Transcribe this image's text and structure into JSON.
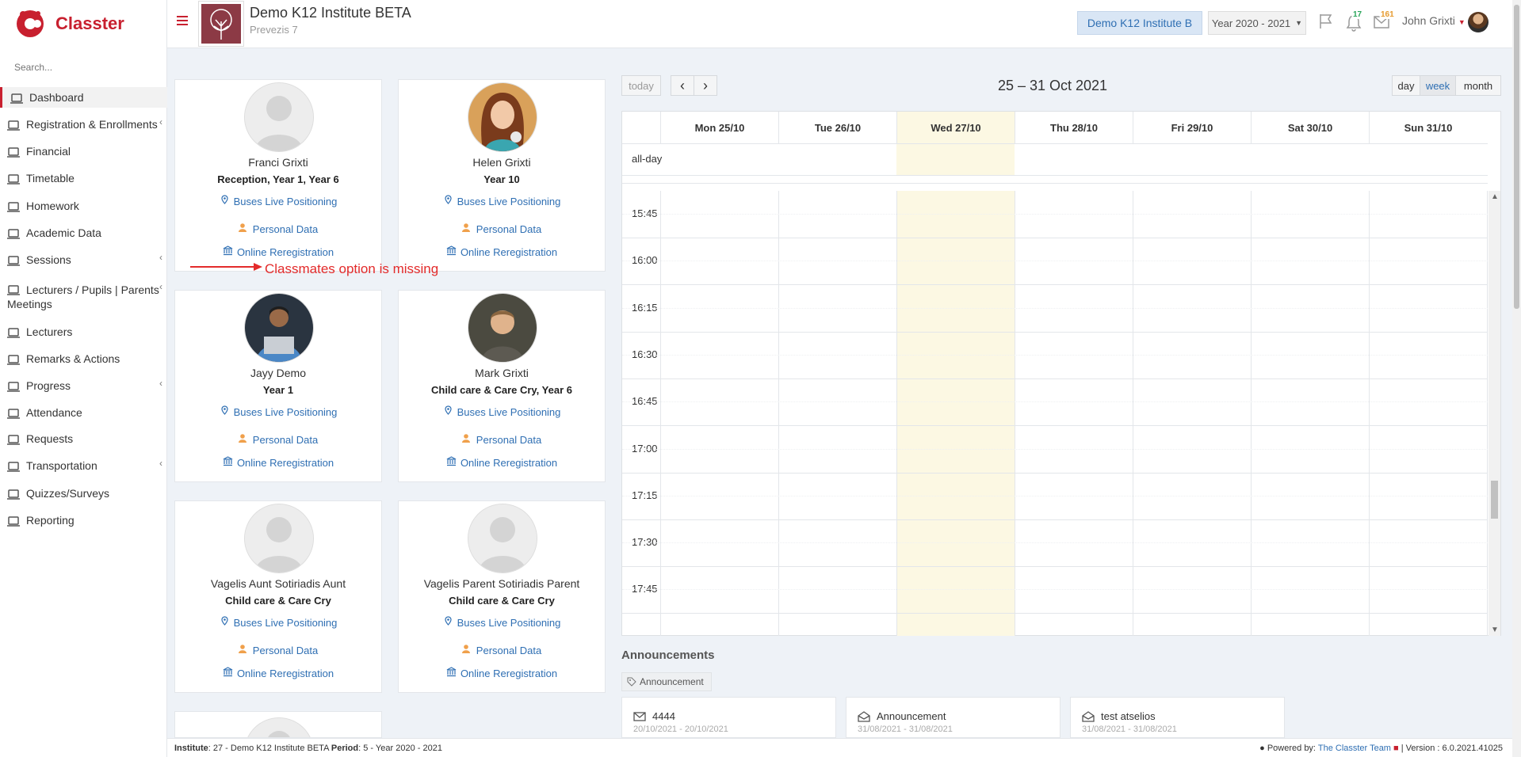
{
  "app": {
    "brand": "Classter"
  },
  "sidebar": {
    "search_placeholder": "Search...",
    "items": [
      {
        "label": "Dashboard",
        "icon": "laptop-icon"
      },
      {
        "label": "Registration & Enrollments",
        "icon": "bank-icon"
      },
      {
        "label": "Financial",
        "icon": "coins-icon"
      },
      {
        "label": "Timetable",
        "icon": "calendar-icon"
      },
      {
        "label": "Homework",
        "icon": "list-icon"
      },
      {
        "label": "Academic Data",
        "icon": "chart-icon"
      },
      {
        "label": "Sessions",
        "icon": "coins-icon"
      },
      {
        "label": "Lecturers / Pupils | Parents",
        "label2": "Meetings",
        "icon": "users-icon"
      },
      {
        "label": "Lecturers",
        "icon": "user-icon"
      },
      {
        "label": "Remarks & Actions",
        "icon": "shuffle-icon"
      },
      {
        "label": "Progress",
        "icon": "graduation-cap-icon"
      },
      {
        "label": "Attendance",
        "icon": "user-check-icon"
      },
      {
        "label": "Requests",
        "icon": "document-icon"
      },
      {
        "label": "Transportation",
        "icon": "bus-icon"
      },
      {
        "label": "Quizzes/Surveys",
        "icon": "list-icon"
      },
      {
        "label": "Reporting",
        "icon": "printer-icon"
      }
    ]
  },
  "header": {
    "institute_title": "Demo K12 Institute BETA",
    "institute_subtitle": "Prevezis 7",
    "institute_button": "Demo K12 Institute B",
    "year_select": "Year 2020 - 2021",
    "notifications_count": "17",
    "messages_count": "161",
    "user_name": "John Grixti"
  },
  "cards": [
    {
      "name": "Franci Grixti",
      "year": "Reception, Year 1, Year 6",
      "photo": "placeholder"
    },
    {
      "name": "Helen Grixti",
      "year": "Year 10",
      "photo": "girl"
    },
    {
      "name": "Jayy Demo",
      "year": "Year 1",
      "photo": "man"
    },
    {
      "name": "Mark Grixti",
      "year": "Child care & Care Cry, Year 6",
      "photo": "boy"
    },
    {
      "name": "Vagelis Aunt Sotiriadis Aunt",
      "year": "Child care & Care Cry",
      "photo": "placeholder"
    },
    {
      "name": "Vagelis Parent Sotiriadis Parent",
      "year": "Child care & Care Cry",
      "photo": "placeholder"
    }
  ],
  "card_links": {
    "buses": "Buses Live Positioning",
    "personal": "Personal Data",
    "rereg": "Online Reregistration"
  },
  "annotation": "Classmates option is missing",
  "calendar": {
    "title": "25 – 31 Oct 2021",
    "today": "today",
    "prev": "‹",
    "next": "›",
    "view_day": "day",
    "view_week": "week",
    "view_month": "month",
    "allday": "all-day",
    "days": [
      "Mon 25/10",
      "Tue 26/10",
      "Wed 27/10",
      "Thu 28/10",
      "Fri 29/10",
      "Sat 30/10",
      "Sun 31/10"
    ],
    "today_index": 2,
    "times": [
      "15:45",
      "16:00",
      "16:15",
      "16:30",
      "16:45",
      "17:00",
      "17:15",
      "17:30",
      "17:45"
    ]
  },
  "announcements": {
    "title": "Announcements",
    "tag": "Announcement",
    "items": [
      {
        "title": "4444",
        "dates": "20/10/2021 - 20/10/2021",
        "icon": "envelope-icon"
      },
      {
        "title": "Announcement",
        "dates": "31/08/2021 - 31/08/2021",
        "icon": "envelope-open-icon"
      },
      {
        "title": "test atselios",
        "dates": "31/08/2021 - 31/08/2021",
        "icon": "envelope-open-icon"
      }
    ]
  },
  "footer": {
    "institute_label": "Institute",
    "institute_value": ": 27 - Demo K12 Institute BETA",
    "period_label": "Period",
    "period_value": ": 5 - Year 2020 - 2021",
    "powered_label": "Powered by:",
    "powered_link": "The Classter Team",
    "version": "| Version : 6.0.2021.41025"
  },
  "colors": {
    "brand": "#c8202f",
    "link": "#2f6fb3",
    "today_col": "#fcf8e3"
  }
}
